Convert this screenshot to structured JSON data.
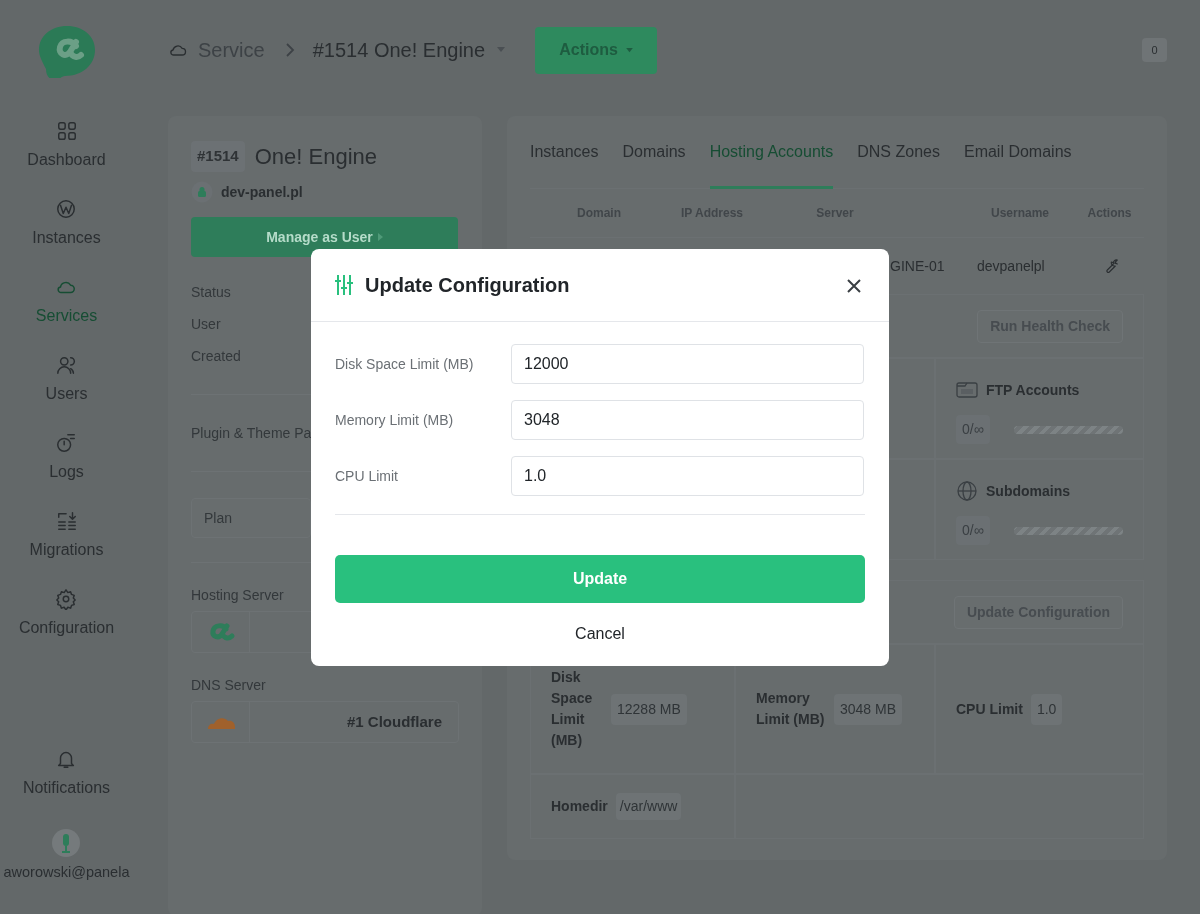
{
  "sidebar": {
    "items": [
      {
        "label": "Dashboard",
        "selected": false
      },
      {
        "label": "Instances",
        "selected": false
      },
      {
        "label": "Services",
        "selected": true
      },
      {
        "label": "Users",
        "selected": false
      },
      {
        "label": "Logs",
        "selected": false
      },
      {
        "label": "Migrations",
        "selected": false
      },
      {
        "label": "Configuration",
        "selected": false
      }
    ],
    "notifications": {
      "label": "Notifications"
    },
    "user": {
      "email": "aworowski@panela"
    }
  },
  "header": {
    "breadcrumb": [
      "Service",
      "#1514 One! Engine"
    ],
    "actions_button": "Actions",
    "notification_count": "0"
  },
  "service_card": {
    "id_badge": "#1514",
    "title": "One! Engine",
    "domain": "dev-panel.pl",
    "manage_button": "Manage as User",
    "details": [
      "Status",
      "User",
      "Created"
    ],
    "plugin_heading": "Plugin & Theme Pa",
    "plan_label": "Plan",
    "hosting_server_label": "Hosting Server",
    "dns_server_label": "DNS Server",
    "dns_server_name": "#1 Cloudflare"
  },
  "tabs": [
    {
      "label": "Instances",
      "selected": false
    },
    {
      "label": "Domains",
      "selected": false
    },
    {
      "label": "Hosting Accounts",
      "selected": true
    },
    {
      "label": "DNS Zones",
      "selected": false
    },
    {
      "label": "Email Domains",
      "selected": false
    }
  ],
  "table": {
    "columns": [
      "Domain",
      "IP Address",
      "Server",
      "Username",
      "Actions"
    ],
    "rows": [
      {
        "server": "GINE-01",
        "username": "devpanelpl"
      }
    ]
  },
  "health_button": "Run Health Check",
  "stats": [
    {
      "name": "FTP Accounts",
      "usage": "0/∞",
      "level": 1
    },
    {
      "name": "Subdomains",
      "usage": "0/∞",
      "level": 1
    }
  ],
  "update_config_button": "Update Configuration",
  "limits": [
    {
      "label": "Disk Space Limit (MB)",
      "value": "12288 MB"
    },
    {
      "label": "Memory Limit (MB)",
      "value": "3048 MB"
    },
    {
      "label": "CPU Limit",
      "value": "1.0"
    }
  ],
  "homedir": {
    "label": "Homedir",
    "value": "/var/www"
  },
  "modal": {
    "title": "Update Configuration",
    "fields": [
      {
        "label": "Disk Space Limit (MB)",
        "value": "12000"
      },
      {
        "label": "Memory Limit (MB)",
        "value": "3048"
      },
      {
        "label": "CPU Limit",
        "value": "1.0"
      }
    ],
    "submit": "Update",
    "cancel": "Cancel"
  }
}
